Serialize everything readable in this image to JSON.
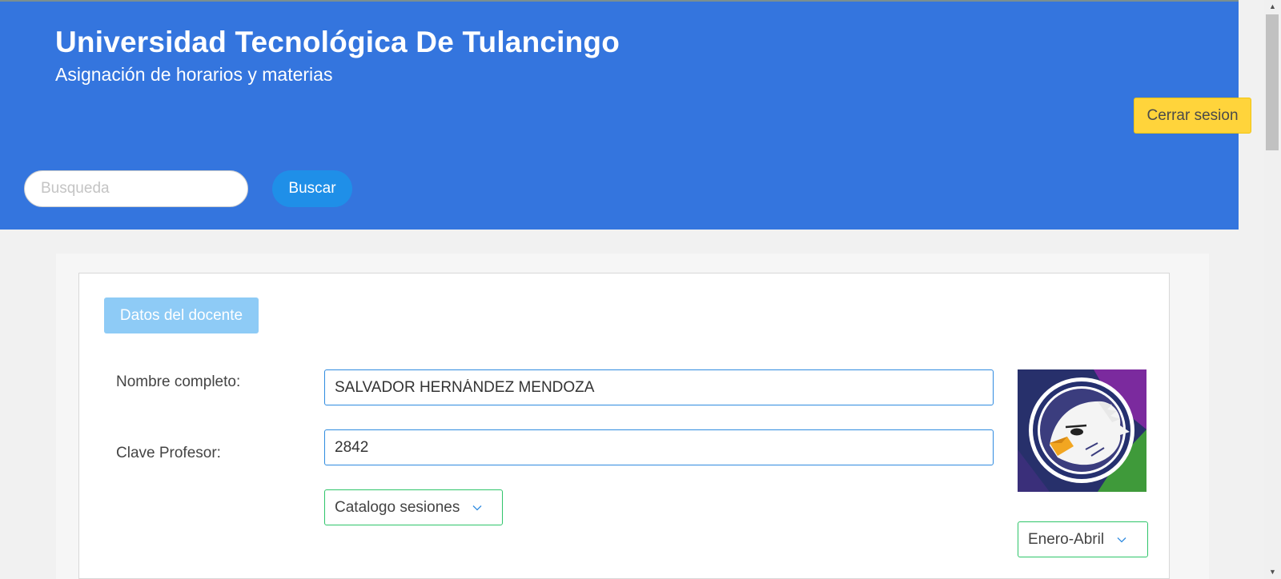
{
  "header": {
    "title": "Universidad Tecnológica De Tulancingo",
    "subtitle": "Asignación de horarios y materias",
    "logout_label": "Cerrar sesion",
    "search_placeholder": "Busqueda",
    "search_button": "Buscar"
  },
  "card": {
    "tag": "Datos del docente",
    "fields": {
      "name_label": "Nombre completo:",
      "name_value": "SALVADOR HERNÁNDEZ MENDOZA",
      "id_label": "Clave Profesor:",
      "id_value": "2842"
    },
    "session_select": "Catalogo sesiones",
    "period_select": "Enero-Abril"
  },
  "colors": {
    "header_bg": "#3475de",
    "logout_bg": "#ffd43b",
    "search_btn_bg": "#1f8fe8",
    "tag_bg": "#8ecbf6",
    "input_border": "#2f8be0",
    "select_border": "#2fc56a"
  },
  "icons": {
    "chevron": "chevron-down-icon",
    "avatar": "eagle-logo"
  }
}
